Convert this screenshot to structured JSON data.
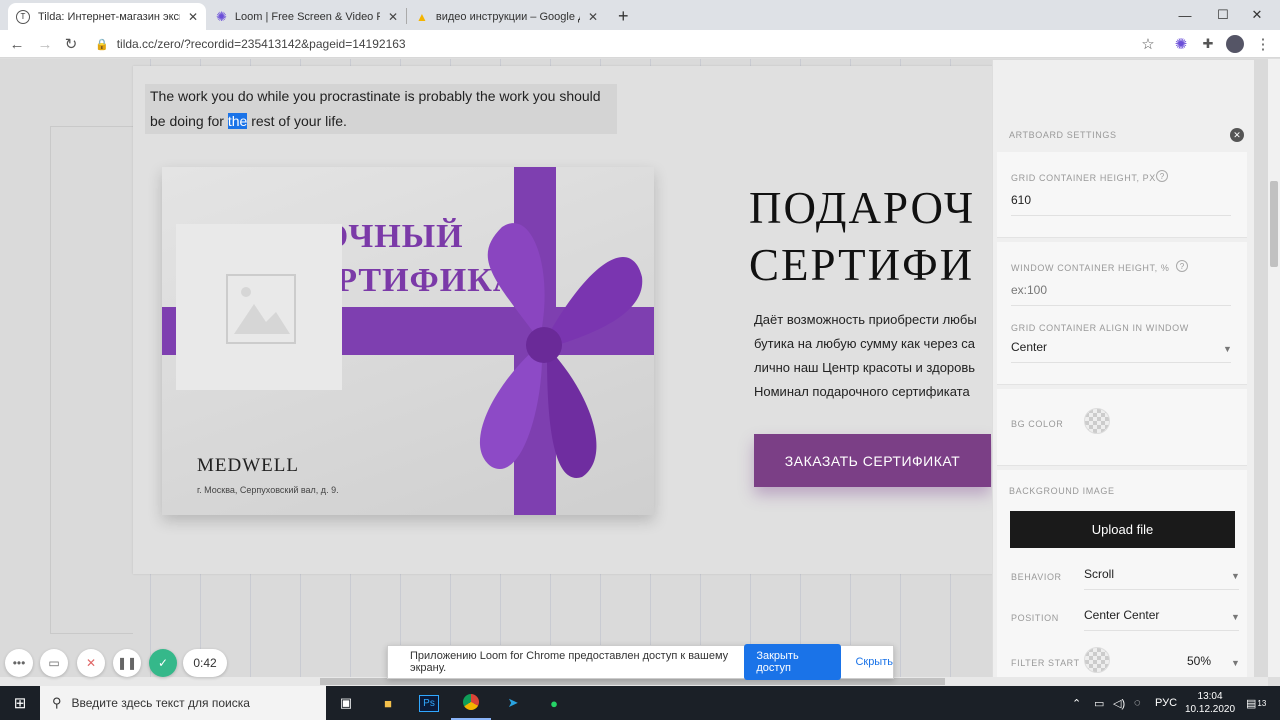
{
  "browser": {
    "tabs": [
      {
        "title": "Tilda: Интернет-магазин экскл",
        "icon": "tilda-icon",
        "active": true
      },
      {
        "title": "Loom | Free Screen & Video Reco",
        "icon": "loom-icon",
        "active": false
      },
      {
        "title": "видео инструкции – Google Ди",
        "icon": "google-drive-icon",
        "active": false
      }
    ],
    "url": "tilda.cc/zero/?recordid=235413142&pageid=14192163"
  },
  "canvas": {
    "quote_part1": "The work you do while you procrastinate is probably the work you should be doing for ",
    "quote_highlight": "the",
    "quote_part2": " rest of your life.",
    "gift_line1": "ПОДАРОЧНЫЙ",
    "gift_line2": "СЕРТИФИКАТ",
    "brand": "MEDWELL",
    "address": "г. Москва, Серпуховский вал, д. 9.",
    "title_line1": "ПОДАРОЧ",
    "title_line2": "СЕРТИФИ",
    "desc_lines": [
      "Даёт возможность приобрести любы",
      "бутика на любую сумму как через са",
      "лично наш Центр красоты и здоровь",
      "Номинал подарочного сертификата"
    ],
    "order_button": "ЗАКАЗАТЬ СЕРТИФИКАТ"
  },
  "panel": {
    "title": "ARTBOARD SETTINGS",
    "grid_height_label": "GRID CONTAINER HEIGHT, PX",
    "grid_height_value": "610",
    "window_height_label": "WINDOW CONTAINER HEIGHT, %",
    "window_height_placeholder": "ex:100",
    "align_label": "GRID CONTAINER ALIGN IN WINDOW",
    "align_value": "Center",
    "bg_color_label": "BG COLOR",
    "bg_image_label": "BACKGROUND IMAGE",
    "upload_button": "Upload file",
    "behavior_label": "BEHAVIOR",
    "behavior_value": "Scroll",
    "position_label": "POSITION",
    "position_value": "Center Center",
    "filter_start_label": "FILTER START",
    "filter_start_value": "50%"
  },
  "loom": {
    "timer": "0:42",
    "notice_text": "Приложению Loom for Chrome предоставлен доступ к вашему экрану.",
    "stop_sharing": "Закрыть доступ",
    "hide": "Скрыть"
  },
  "taskbar": {
    "search_placeholder": "Введите здесь текст для поиска",
    "lang": "РУС",
    "time": "13:04",
    "date": "10.12.2020",
    "notifications": "13"
  },
  "colors": {
    "accent_purple": "#7b3f86",
    "ribbon_purple": "#7e3fb0",
    "highlight_blue": "#1a73e8"
  }
}
